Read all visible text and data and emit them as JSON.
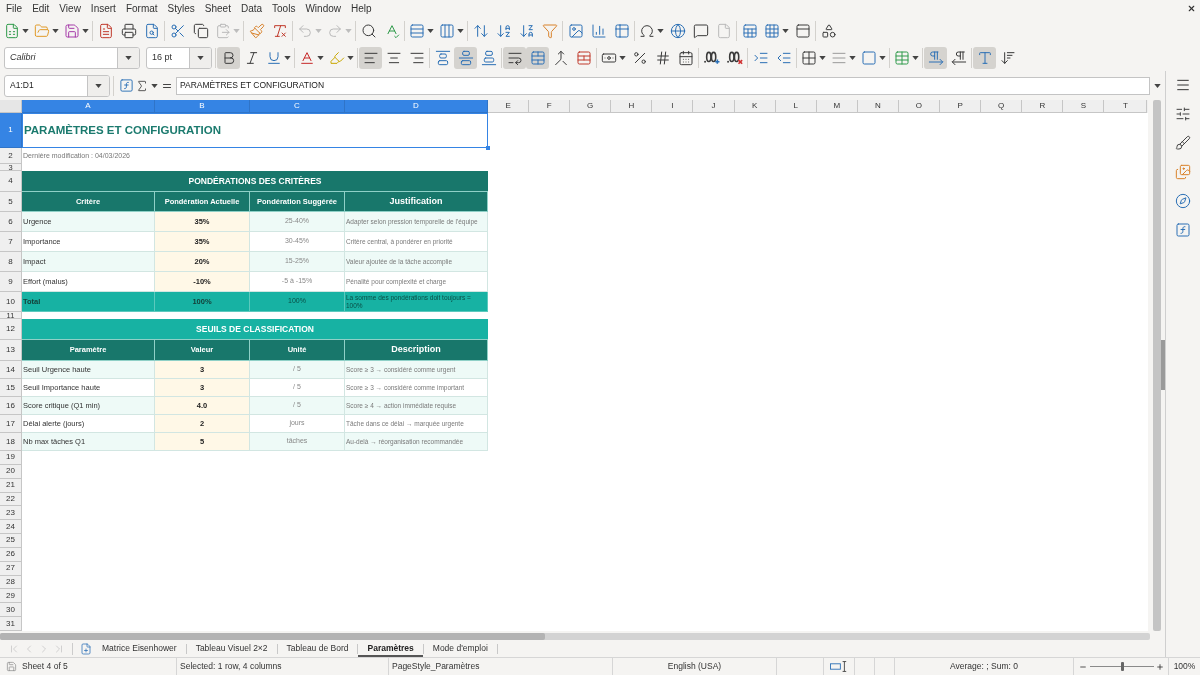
{
  "menu_bar": {
    "items": [
      "File",
      "Edit",
      "View",
      "Insert",
      "Format",
      "Styles",
      "Sheet",
      "Data",
      "Tools",
      "Window",
      "Help"
    ]
  },
  "standard_toolbar": {
    "buttons": [
      {
        "disabled": false
      },
      {
        "disabled": false
      },
      {
        "disabled": false
      },
      {
        "disabled": false
      },
      {
        "disabled": false
      },
      {
        "disabled": false
      },
      {
        "disabled": false
      },
      {
        "disabled": false
      },
      {
        "disabled": true
      },
      {
        "disabled": false
      },
      {
        "disabled": false
      },
      {
        "disabled": true
      },
      {
        "disabled": true
      },
      {
        "disabled": false
      },
      {
        "disabled": false
      },
      {
        "disabled": false
      },
      {
        "disabled": false
      },
      {
        "disabled": false
      },
      {
        "disabled": false
      },
      {
        "disabled": false
      },
      {
        "disabled": false
      },
      {
        "disabled": false
      },
      {
        "disabled": false
      },
      {
        "disabled": false
      },
      {
        "disabled": false
      },
      {
        "disabled": false
      },
      {
        "disabled": false
      },
      {
        "disabled": true
      },
      {
        "disabled": false
      },
      {
        "disabled": false
      },
      {
        "disabled": false
      },
      {
        "disabled": false
      }
    ]
  },
  "formatting_toolbar": {
    "font_name": "Calibri",
    "font_size": "16 pt",
    "toggles": [
      {
        "pressed": true
      },
      {
        "pressed": false
      },
      {
        "pressed": false
      },
      {
        "pressed": true
      },
      {
        "pressed": false
      },
      {
        "pressed": false
      },
      {
        "pressed": false
      },
      {
        "pressed": true
      },
      {
        "pressed": false
      },
      {
        "pressed": true
      },
      {
        "pressed": true
      },
      {
        "pressed": false
      },
      {
        "pressed": false
      },
      {
        "pressed": true
      },
      {
        "pressed": false
      },
      {
        "pressed": true
      },
      {
        "pressed": false
      }
    ]
  },
  "formula_bar": {
    "name_box": "A1:D1",
    "content": "PARAMÈTRES ET CONFIGURATION"
  },
  "sheet": {
    "columns": [
      {
        "label": "A",
        "selected": true
      },
      {
        "label": "B",
        "selected": true
      },
      {
        "label": "C",
        "selected": true
      },
      {
        "label": "D",
        "selected": true
      },
      {
        "label": "E",
        "selected": false
      },
      {
        "label": "F",
        "selected": false
      },
      {
        "label": "G",
        "selected": false
      },
      {
        "label": "H",
        "selected": false
      },
      {
        "label": "I",
        "selected": false
      },
      {
        "label": "J",
        "selected": false
      },
      {
        "label": "K",
        "selected": false
      },
      {
        "label": "L",
        "selected": false
      },
      {
        "label": "M",
        "selected": false
      },
      {
        "label": "N",
        "selected": false
      },
      {
        "label": "O",
        "selected": false
      },
      {
        "label": "P",
        "selected": false
      },
      {
        "label": "Q",
        "selected": false
      },
      {
        "label": "R",
        "selected": false
      },
      {
        "label": "S",
        "selected": false
      },
      {
        "label": "T",
        "selected": false
      }
    ],
    "rows": [
      {
        "label": "1",
        "selected": true
      },
      {
        "label": "2",
        "selected": false
      },
      {
        "label": "3",
        "selected": false
      },
      {
        "label": "4",
        "selected": false
      },
      {
        "label": "5",
        "selected": false
      },
      {
        "label": "6",
        "selected": false
      },
      {
        "label": "7",
        "selected": false
      },
      {
        "label": "8",
        "selected": false
      },
      {
        "label": "9",
        "selected": false
      },
      {
        "label": "10",
        "selected": false
      },
      {
        "label": "11",
        "selected": false
      },
      {
        "label": "12",
        "selected": false
      },
      {
        "label": "13",
        "selected": false
      },
      {
        "label": "14",
        "selected": false
      },
      {
        "label": "15",
        "selected": false
      },
      {
        "label": "16",
        "selected": false
      },
      {
        "label": "17",
        "selected": false
      },
      {
        "label": "18",
        "selected": false
      },
      {
        "label": "19",
        "selected": false
      },
      {
        "label": "20",
        "selected": false
      },
      {
        "label": "21",
        "selected": false
      },
      {
        "label": "22",
        "selected": false
      },
      {
        "label": "23",
        "selected": false
      },
      {
        "label": "24",
        "selected": false
      },
      {
        "label": "25",
        "selected": false
      },
      {
        "label": "26",
        "selected": false
      },
      {
        "label": "27",
        "selected": false
      },
      {
        "label": "28",
        "selected": false
      },
      {
        "label": "29",
        "selected": false
      },
      {
        "label": "30",
        "selected": false
      },
      {
        "label": "31",
        "selected": false
      }
    ],
    "title": {
      "text": "PARAMÈTRES ET CONFIGURATION",
      "selected": true
    },
    "last_modified": "Dernière modification : 04/03/2026",
    "tables": [
      {
        "title": "PONDÉRATIONS DES CRITÈRES",
        "color": "#18776b",
        "headers": [
          "Critère",
          "Pondération Actuelle",
          "Pondération Suggérée",
          "Justification"
        ],
        "rows": [
          {
            "kind": "data",
            "shaded": true,
            "cells": [
              "Urgence",
              "35%",
              "25-40%",
              "Adapter selon pression temporelle de l'équipe"
            ]
          },
          {
            "kind": "data",
            "shaded": false,
            "cells": [
              "Importance",
              "35%",
              "30-45%",
              "Critère central, à pondérer en priorité"
            ]
          },
          {
            "kind": "data",
            "shaded": true,
            "cells": [
              "Impact",
              "20%",
              "15-25%",
              "Valeur ajoutée de la tâche accomplie"
            ]
          },
          {
            "kind": "data",
            "shaded": false,
            "cells": [
              "Effort (malus)",
              "-10%",
              "-5 à -15%",
              "Pénalité pour complexité et charge"
            ]
          },
          {
            "kind": "total",
            "shaded": false,
            "cells": [
              "Total",
              "100%",
              "100%",
              "La somme des pondérations doit toujours = 100%"
            ]
          }
        ]
      },
      {
        "title": "SEUILS DE CLASSIFICATION",
        "color": "#17b2a3",
        "headers": [
          "Paramètre",
          "Valeur",
          "Unité",
          "Description"
        ],
        "rows": [
          {
            "kind": "data",
            "shaded": true,
            "cells": [
              "Seuil Urgence haute",
              "3",
              "/ 5",
              "Score ≥ 3 → considéré comme urgent"
            ]
          },
          {
            "kind": "data",
            "shaded": false,
            "cells": [
              "Seuil Importance haute",
              "3",
              "/ 5",
              "Score ≥ 3 → considéré comme important"
            ]
          },
          {
            "kind": "data",
            "shaded": true,
            "cells": [
              "Score critique (Q1 min)",
              "4.0",
              "/ 5",
              "Score ≥ 4 → action immédiate requise"
            ]
          },
          {
            "kind": "data",
            "shaded": false,
            "cells": [
              "Délai alerte (jours)",
              "2",
              "jours",
              "Tâche dans ce délai → marquée urgente"
            ]
          },
          {
            "kind": "data",
            "shaded": true,
            "cells": [
              "Nb max tâches Q1",
              "5",
              "tâches",
              "Au-delà → réorganisation recommandée"
            ]
          }
        ]
      }
    ]
  },
  "sheet_tabs": {
    "navigation_disabled": true,
    "tabs": [
      {
        "label": "Matrice Eisenhower",
        "selected": false
      },
      {
        "label": "Tableau Visuel 2×2",
        "selected": false
      },
      {
        "label": "Tableau de Bord",
        "selected": false
      },
      {
        "label": "Paramètres",
        "selected": true
      },
      {
        "label": "Mode d'emploi",
        "selected": false
      }
    ]
  },
  "status_bar": {
    "sheet": "Sheet 4 of 5",
    "selection": "Selected: 1 row, 4 columns",
    "page_style": "PageStyle_Paramètres",
    "language": "English (USA)",
    "summary": "Average: ; Sum: 0",
    "zoom": {
      "level": 0.5,
      "reading": "100%"
    }
  }
}
